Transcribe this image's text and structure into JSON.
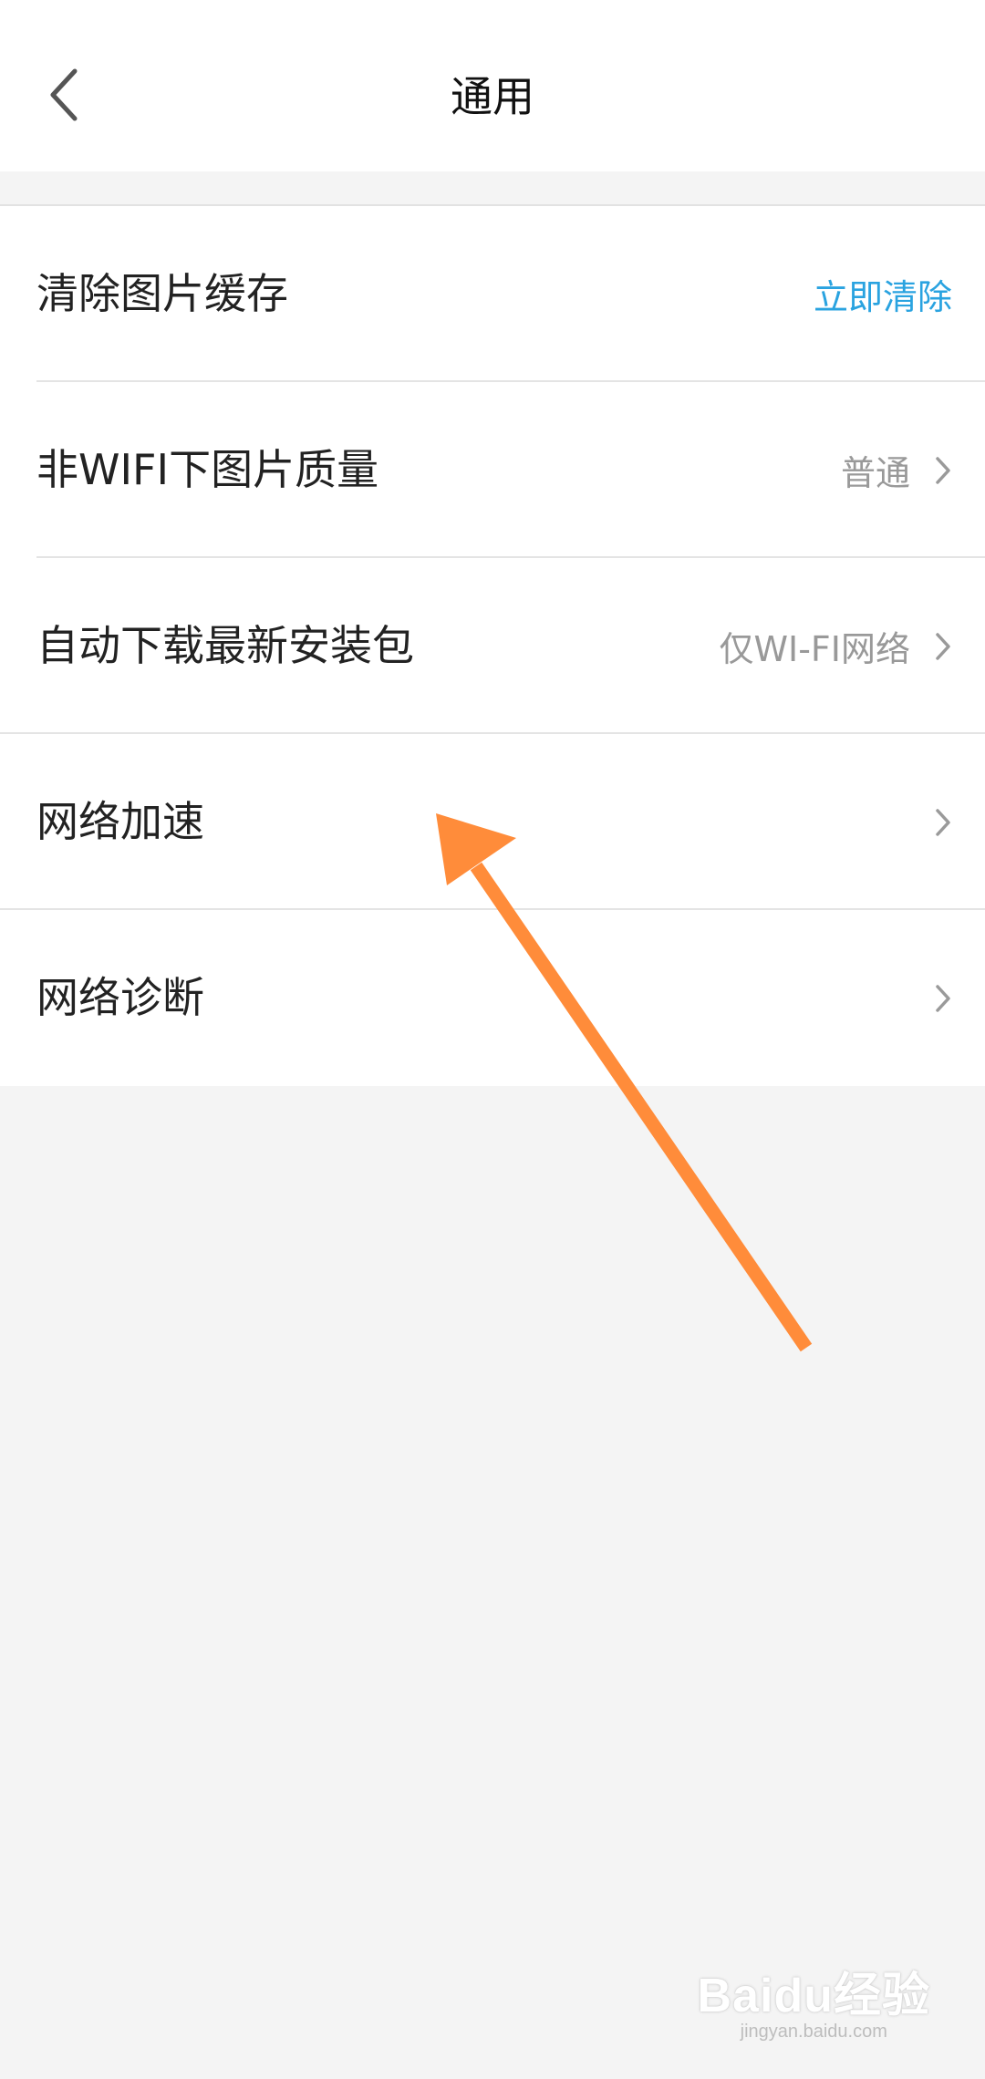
{
  "header": {
    "title": "通用",
    "back_icon": "chevron-left-icon"
  },
  "settings": [
    {
      "label": "清除图片缓存",
      "action": "立即清除"
    },
    {
      "label": "非WIFI下图片质量",
      "value": "普通"
    },
    {
      "label": "自动下载最新安装包",
      "value": "仅WI-FI网络"
    },
    {
      "label": "网络加速"
    },
    {
      "label": "网络诊断"
    }
  ],
  "watermark": {
    "logo": "Baidu经验",
    "url": "jingyan.baidu.com"
  },
  "colors": {
    "accent": "#2aa3e0",
    "annotation_arrow": "#ff8c3a",
    "background": "#f4f4f4"
  }
}
